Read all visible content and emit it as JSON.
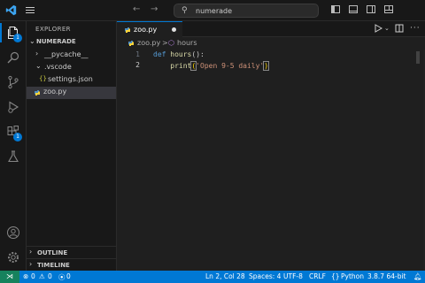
{
  "search": {
    "text": "numerade"
  },
  "sidebar": {
    "title": "EXPLORER",
    "root": "NUMERADE",
    "items": [
      {
        "label": "__pycache__"
      },
      {
        "label": ".vscode"
      },
      {
        "label": "settings.json",
        "icon_text": "{}"
      },
      {
        "label": "zoo.py"
      }
    ],
    "sections": [
      {
        "label": "OUTLINE"
      },
      {
        "label": "TIMELINE"
      }
    ]
  },
  "activity": {
    "explorer_badge": "1",
    "extensions_badge": "1"
  },
  "editor": {
    "tab_label": "zoo.py",
    "breadcrumb": {
      "file": "zoo.py",
      "separator": ">",
      "symbol": "hours"
    },
    "line_numbers": [
      "1",
      "2"
    ],
    "lines": [
      {
        "kw": "def",
        "fn": "hours",
        "rest": "():"
      },
      {
        "indent": "    ",
        "fn": "print",
        "open": "(",
        "str": "'Open 9-5 daily'",
        "close": ")"
      }
    ]
  },
  "statusbar": {
    "errors": "0",
    "warnings": "0",
    "ports": "0",
    "position": "Ln 2, Col 28",
    "spaces": "Spaces: 4",
    "encoding": "UTF-8",
    "eol": "CRLF",
    "language": "Python",
    "interpreter": "3.8.7 64-bit"
  },
  "colors": {
    "accent": "#0078d4",
    "remote": "#16825d",
    "keyword": "#569cd6",
    "function": "#dcdcaa",
    "string": "#ce9178",
    "bracket": "#ffd700"
  },
  "icons": [
    "vscode-logo-icon",
    "menu-icon",
    "back-arrow-icon",
    "forward-arrow-icon",
    "search-icon",
    "toggle-sidebar-icon",
    "toggle-panel-icon",
    "toggle-secondary-sidebar-icon",
    "customize-layout-icon",
    "explorer-icon",
    "search-view-icon",
    "source-control-icon",
    "run-debug-icon",
    "extensions-icon",
    "testing-icon",
    "account-icon",
    "manage-gear-icon",
    "python-file-icon",
    "run-icon",
    "split-editor-icon",
    "more-actions-icon",
    "remote-icon",
    "error-icon",
    "warning-icon",
    "ports-icon",
    "notifications-bell-icon"
  ]
}
